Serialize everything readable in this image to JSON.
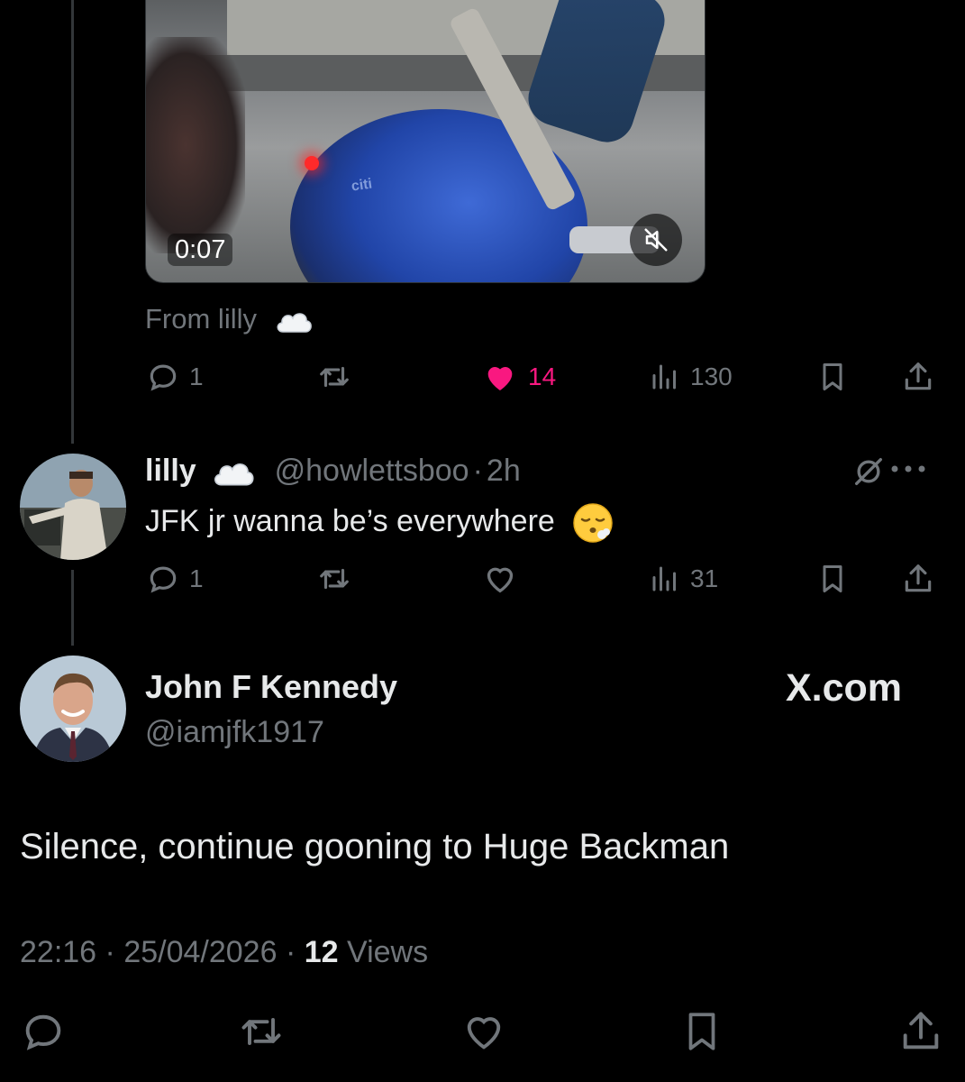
{
  "video": {
    "duration": "0:07",
    "muted": true,
    "brand_text": "citi"
  },
  "from_line": {
    "text": "From lilly"
  },
  "first_tweet_actions": {
    "replies": "1",
    "likes": "14",
    "views": "130",
    "liked": true
  },
  "reply": {
    "name": "lilly",
    "handle": "@howlettsboo",
    "separator": "·",
    "time": "2h",
    "text": "JFK jr wanna be’s everywhere",
    "replies": "1",
    "views": "31"
  },
  "main_tweet": {
    "name": "John F Kennedy",
    "handle": "@iamjfk1917",
    "source_logo": "X.com",
    "text": "Silence, continue gooning to Huge Backman",
    "time": "22:16",
    "date": "25/04/2026",
    "views_count": "12",
    "views_label": "Views"
  },
  "colors": {
    "background": "#000000",
    "text": "#e7e9ea",
    "muted": "#71767b",
    "like": "#f91880",
    "thread_line": "#333639"
  },
  "icons": [
    "reply-icon",
    "retweet-icon",
    "like-icon",
    "views-icon",
    "bookmark-icon",
    "share-icon",
    "mute-icon",
    "grok-icon",
    "more-icon",
    "cloud-icon",
    "exhale-face-icon"
  ]
}
